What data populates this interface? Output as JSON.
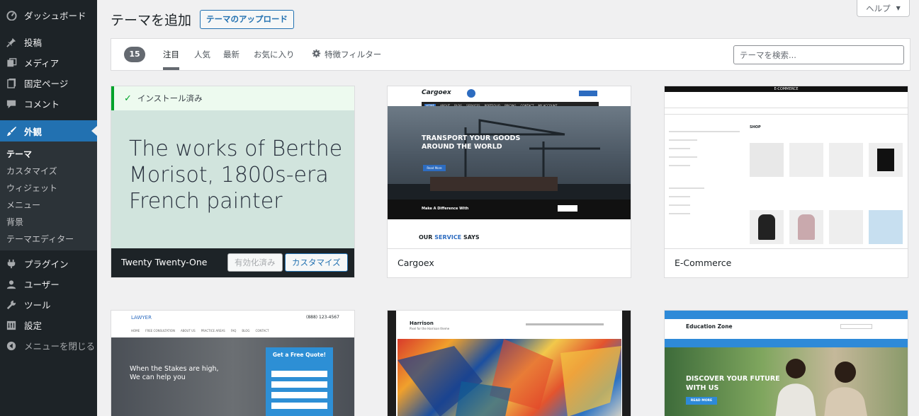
{
  "sidebar": {
    "items": [
      {
        "label": "ダッシュボード",
        "icon": "dashboard-icon"
      },
      {
        "label": "投稿",
        "icon": "pin-icon"
      },
      {
        "label": "メディア",
        "icon": "media-icon"
      },
      {
        "label": "固定ページ",
        "icon": "page-icon"
      },
      {
        "label": "コメント",
        "icon": "comment-icon"
      },
      {
        "label": "外観",
        "icon": "appearance-icon"
      }
    ],
    "submenu": [
      "テーマ",
      "カスタマイズ",
      "ウィジェット",
      "メニュー",
      "背景",
      "テーマエディター"
    ],
    "items_after": [
      {
        "label": "プラグイン",
        "icon": "plugin-icon"
      },
      {
        "label": "ユーザー",
        "icon": "user-icon"
      },
      {
        "label": "ツール",
        "icon": "tool-icon"
      },
      {
        "label": "設定",
        "icon": "settings-icon"
      }
    ],
    "collapse_label": "メニューを閉じる"
  },
  "header": {
    "title": "テーマを追加",
    "upload_label": "テーマのアップロード",
    "help_label": "ヘルプ"
  },
  "filter": {
    "count": "15",
    "tabs": [
      "注目",
      "人気",
      "最新",
      "お気に入り"
    ],
    "feature_filter_label": "特徴フィルター",
    "search_placeholder": "テーマを検索..."
  },
  "themes": [
    {
      "name": "Twenty Twenty-One",
      "installed_label": "インストール済み",
      "headline": "The works of Berthe Morisot, 1800s-era French painter",
      "activated_label": "有効化済み",
      "customize_label": "カスタマイズ"
    },
    {
      "name": "Cargoex",
      "logo": "Cargoex",
      "hero_line1": "TRANSPORT YOUR GOODS",
      "hero_line2": "AROUND THE WORLD",
      "hero_button": "Read More",
      "banner_text": "Make A Difference With",
      "section_heading_a": "OUR",
      "section_heading_b": "SERVICE",
      "section_heading_c": "SAYS",
      "nav": [
        "HOME",
        "ABOUT",
        "BLOG",
        "SERVICES",
        "PORTFOLIO",
        "PRICING",
        "CONTACT",
        "MY ACCOUNT"
      ]
    },
    {
      "name": "E-Commerce",
      "top_label": "E-COMMERCE",
      "shop_label": "SHOP"
    },
    {
      "name": "Lawyer",
      "logo": "LAWYER",
      "phone": "(888) 123-4567",
      "hero_line1": "When the Stakes are high,",
      "hero_line2": "We can help you",
      "quote_title": "Get a Free Quote!",
      "nav": [
        "HOME",
        "FREE CONSULTATION",
        "ABOUT US",
        "PRACTICE AREAS",
        "FAQ",
        "BLOG",
        "CONTACT"
      ]
    },
    {
      "name": "Harrison",
      "site_title": "Harrison",
      "tagline": "Pixel for the Harrison theme"
    },
    {
      "name": "Education Zone",
      "site_title": "Education Zone",
      "hero_line1": "DISCOVER YOUR FUTURE",
      "hero_line2": "WITH US",
      "hero_button": "READ MORE"
    }
  ]
}
